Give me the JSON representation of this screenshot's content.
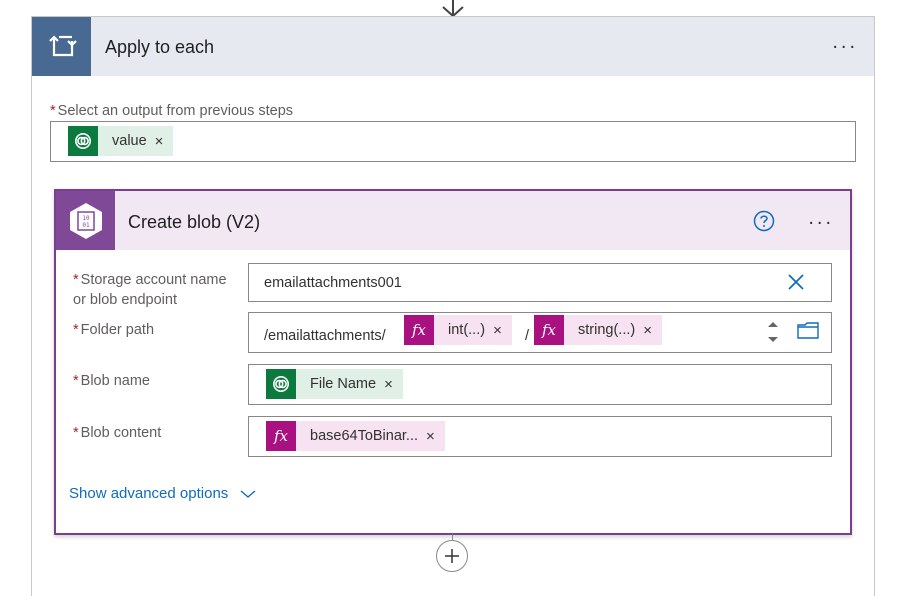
{
  "apply_each": {
    "title": "Apply to each",
    "select_label": "Select an output from previous steps",
    "token_value": "value"
  },
  "create_blob": {
    "title": "Create blob (V2)",
    "fields": {
      "storage_label_line1": "Storage account name",
      "storage_label_line2": "or blob endpoint",
      "storage_value": "emailattachments001",
      "folder_label": "Folder path",
      "folder_prefix": "/emailattachments/",
      "folder_token1": "int(...)",
      "folder_separator": "/",
      "folder_token2": "string(...)",
      "blob_name_label": "Blob name",
      "blob_name_token": "File Name",
      "blob_content_label": "Blob content",
      "blob_content_token": "base64ToBinar..."
    },
    "advanced_label": "Show advanced options"
  },
  "symbols": {
    "required": "*",
    "remove": "×",
    "more": "...",
    "fx": "fx"
  },
  "icons": {
    "loop": "loop-icon",
    "dataverse": "dataverse-icon",
    "blob": "blob-storage-icon",
    "expression": "fx-icon",
    "help": "help-icon",
    "clear": "clear-icon",
    "folder": "folder-icon",
    "chevron": "chevron-down-icon",
    "add": "plus-icon",
    "arrow": "arrow-down-icon"
  },
  "colors": {
    "loop_header": "#486991",
    "blob_accent": "#804998",
    "dataverse_green": "#0c7a3e",
    "expression_pink": "#a8117f",
    "link_blue": "#0f6cbd"
  }
}
